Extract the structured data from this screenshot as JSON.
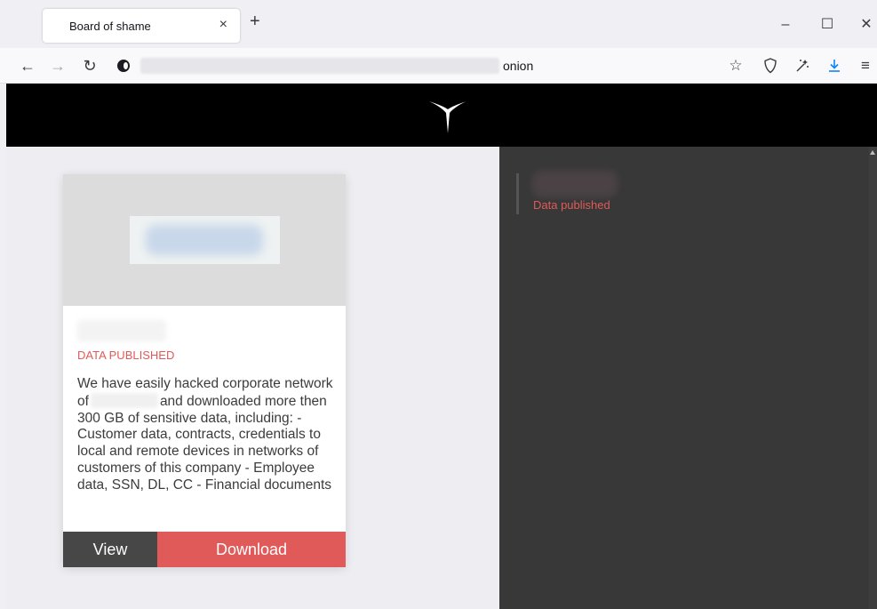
{
  "browser": {
    "tab_title": "Board of shame",
    "tab_close_glyph": "×",
    "new_tab_glyph": "+",
    "url_suffix": "onion",
    "icons": [
      "back-icon",
      "forward-icon",
      "reload-icon",
      "onion-icon",
      "bookmark-star-icon",
      "shield-icon",
      "magic-wand-icon",
      "download-icon",
      "menu-icon",
      "minimize-icon",
      "maximize-icon",
      "close-icon"
    ]
  },
  "card": {
    "status": "DATA PUBLISHED",
    "desc_part1": "We have easily hacked corporate network of",
    "desc_part2": "and downloaded more then 300 GB of sensitive data, including: - Customer data, contracts, credentials to local and remote devices in networks of customers of this company - Employee data, SSN, DL, CC - Financial documents",
    "view_label": "View",
    "download_label": "Download"
  },
  "feed": {
    "items": [
      {
        "status": "Data published"
      }
    ]
  },
  "colors": {
    "accent_red": "#e05a5a",
    "header_black": "#000000",
    "right_panel": "#383838",
    "view_button": "#474747"
  }
}
